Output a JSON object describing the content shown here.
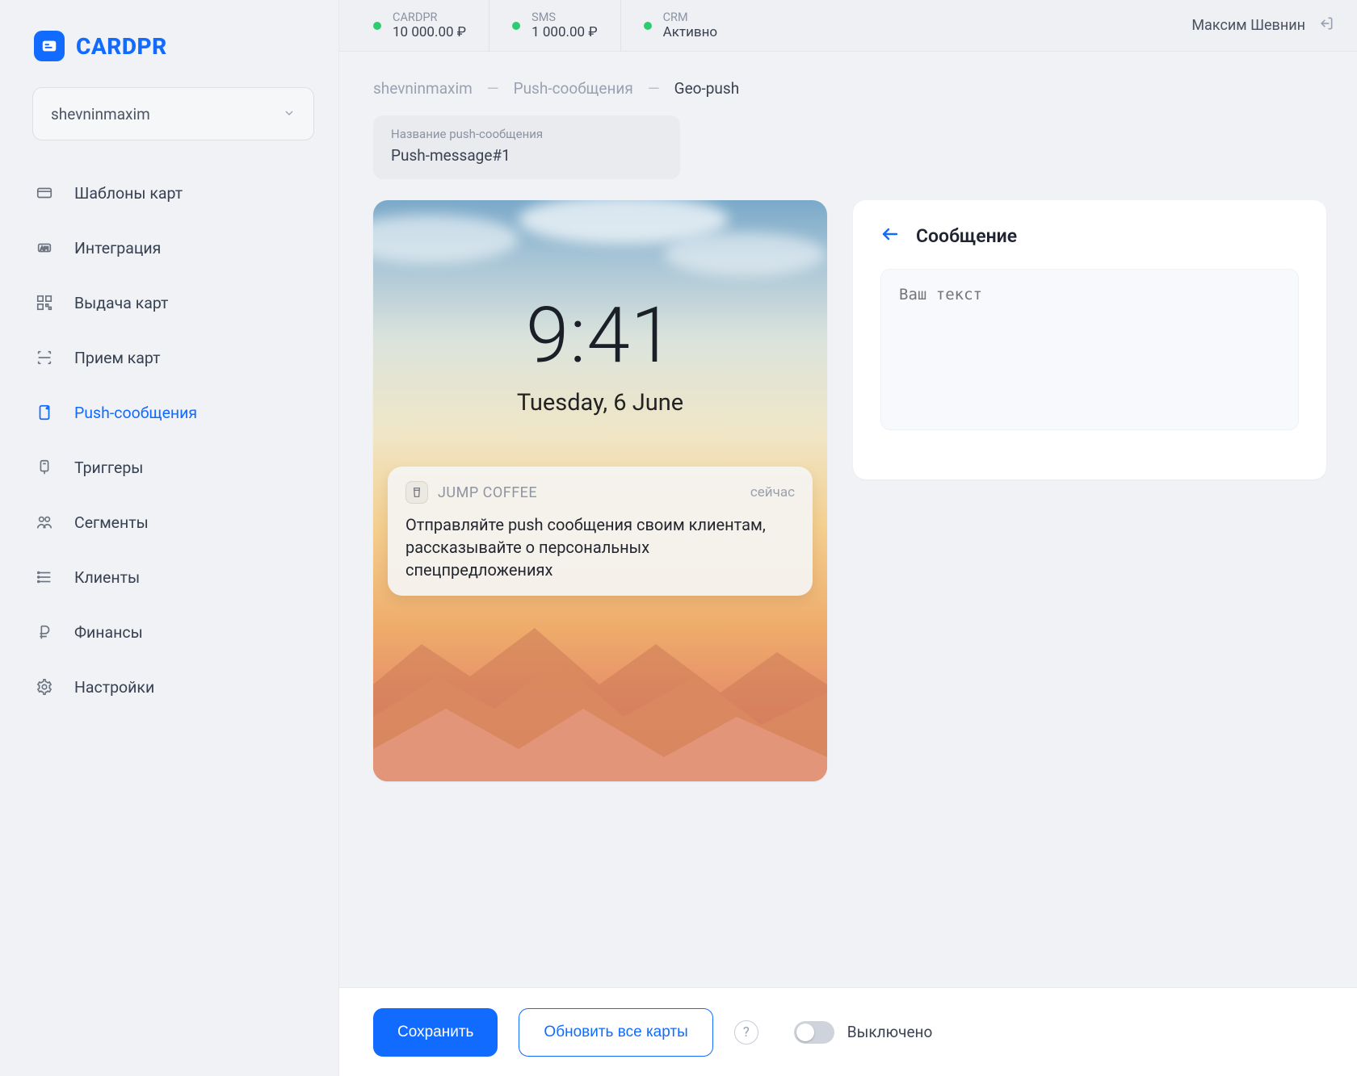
{
  "brand": {
    "name": "CARDPR"
  },
  "account": {
    "selected": "shevninmaxim"
  },
  "sidebar": {
    "items": [
      {
        "icon": "cards-icon",
        "label": "Шаблоны карт"
      },
      {
        "icon": "api-icon",
        "label": "Интеграция"
      },
      {
        "icon": "qr-icon",
        "label": "Выдача карт"
      },
      {
        "icon": "scan-icon",
        "label": "Прием карт"
      },
      {
        "icon": "push-icon",
        "label": "Push-сообщения",
        "active": true
      },
      {
        "icon": "triggers-icon",
        "label": "Триггеры"
      },
      {
        "icon": "segments-icon",
        "label": "Сегменты"
      },
      {
        "icon": "clients-icon",
        "label": "Клиенты"
      },
      {
        "icon": "finance-icon",
        "label": "Финансы"
      },
      {
        "icon": "settings-icon",
        "label": "Настройки"
      }
    ]
  },
  "topbar": {
    "statuses": [
      {
        "label": "CARDPR",
        "value": "10 000.00 ₽"
      },
      {
        "label": "SMS",
        "value": "1 000.00 ₽"
      },
      {
        "label": "CRM",
        "value": "Активно"
      }
    ],
    "user": "Максим Шевнин"
  },
  "breadcrumbs": [
    "shevninmaxim",
    "Push-сообщения",
    "Geo-push"
  ],
  "push_name": {
    "label": "Название push-сообщения",
    "value": "Push-message#1"
  },
  "preview": {
    "clock": "9:41",
    "date": "Tuesday, 6 June",
    "notification": {
      "app": "JUMP COFFEE",
      "ago": "сейчас",
      "body": "Отправляйте push сообщения своим клиентам, рассказывайте о персональных спецпредложениях"
    }
  },
  "panel": {
    "title": "Сообщение",
    "placeholder": "Ваш текст"
  },
  "footer": {
    "save": "Сохранить",
    "update": "Обновить все карты",
    "toggle_label": "Выключено",
    "toggle_on": false
  }
}
